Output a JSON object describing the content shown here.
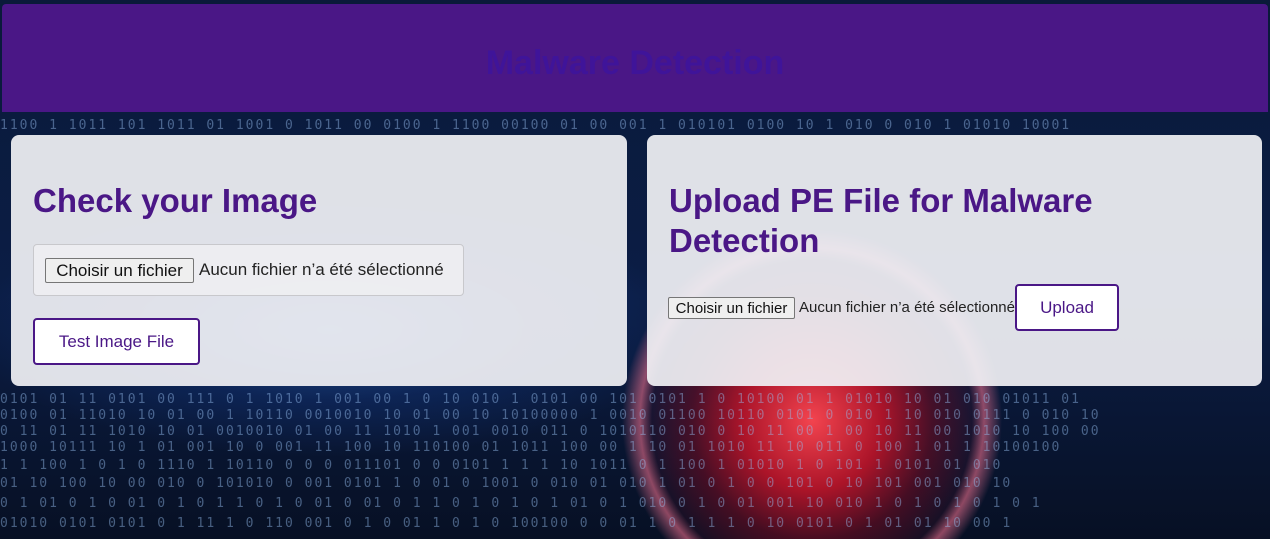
{
  "header": {
    "title": "Malware Detection"
  },
  "image_card": {
    "title": "Check your Image",
    "file_button_label": "Choisir un fichier",
    "file_status": "Aucun fichier n’a été sélectionné",
    "test_button_label": "Test Image File"
  },
  "pe_card": {
    "title": "Upload PE File for Malware Detection",
    "file_button_label": "Choisir un fichier",
    "file_status": "Aucun fichier n’a été sélectionné",
    "upload_button_label": "Upload"
  },
  "background": {
    "binary_rows": [
      "1100 1 1011 101 1011 01 1001 0 1011 00  0100 1 1100  00100 01 00 001 1 010101 0100 10 1 010 0 010 1 01010 10001",
      "0101 01 11 0101 00 111 0 1 1010 1 001 00 1 0 10 010 1 0101 00 101 0101 1 0 10100 01 1 01010 10 01 010 01011 01",
      "0100 01 11010 10 01 00 1 10110 0010010 10 01 00 10 10100000 1 0010 01100 10110 0101 0 010 1 10 010 0111 0 010 10",
      "0 11 01 11 1010 10 01 0010010 01 00 11 1010 1 001 0010 011 0 1010110 010 0 10 11 00 1 00 10 11 00 1010 10 100 00",
      "1000 10111 10 1 01 001 10 0 001 11 100 10 110100 01 1011 100 00 1 10 01 1010 11 10 011 0 100 1 01 1 10100100",
      "1 1 100 1 0 1 0 1110 1 10110 0 0 0 011101 0 0 0101 1 1 1 10 1011 0 1 100 1 01010 1 0 101 1 0101 01 010",
      "01 10 100 10 00 010 0 101010 0 001 0101 1 0 01 0 1001 0 010 01 010 1 01 0 1 0 0 101 0 10 101 001 010 10",
      "0 1 01 0 1 0 01 0 1 0 1 1 0 1 0 01 0 01 0 1 1 0 1 0 1 0 1 01 0 1 010 0 1 0 01 001 10 010 1 0 1 0 1 0 1 0 1",
      "01010 0101 0101 0 1 11 1 0 110 001 0 1 0 01 1 0 1 0 100100 0 0 01 1 0 1 1 1 0 10 0101 0 1 01 01 10 00 1"
    ]
  }
}
